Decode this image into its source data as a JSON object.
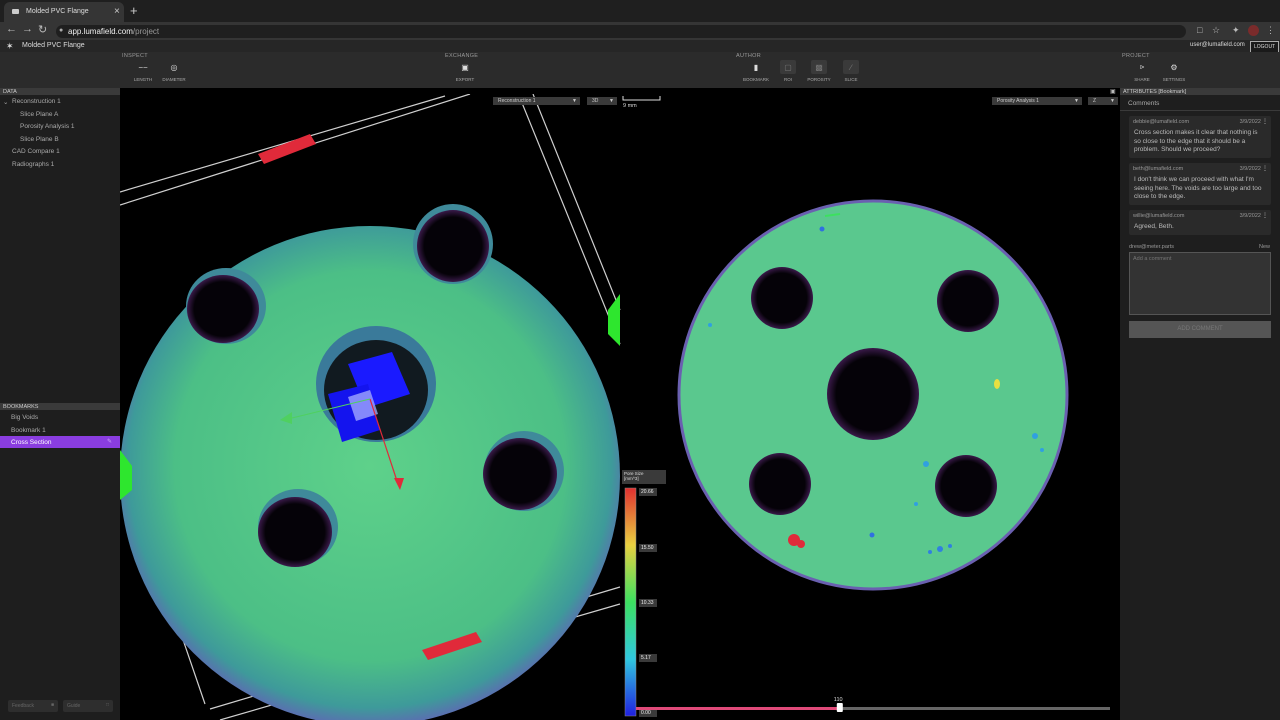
{
  "browser": {
    "tab_title": "Molded PVC Flange",
    "url_host": "app.lumafield.com",
    "url_path": "/project",
    "new_tab": "+",
    "close": "×"
  },
  "app": {
    "title": "Molded PVC Flange",
    "user_email": "user@lumafield.com",
    "logout_label": "LOGOUT"
  },
  "toolbar": {
    "groups": {
      "inspect": "INSPECT",
      "exchange": "EXCHANGE",
      "author": "AUTHOR",
      "project": "PROJECT"
    },
    "buttons": {
      "length": "LENGTH",
      "diameter": "DIAMETER",
      "export": "EXPORT",
      "bookmark": "BOOKMARK",
      "roi": "ROI",
      "porosity": "POROSITY",
      "slice": "SLICE",
      "share": "SHARE",
      "settings": "SETTINGS"
    }
  },
  "data_panel": {
    "header": "DATA",
    "items": [
      {
        "label": "Reconstruction 1"
      },
      {
        "label": "Slice Plane A"
      },
      {
        "label": "Porosity Analysis 1"
      },
      {
        "label": "Slice Plane B"
      },
      {
        "label": "CAD Compare 1"
      },
      {
        "label": "Radiographs 1"
      }
    ]
  },
  "bookmarks": {
    "header": "BOOKMARKS",
    "items": [
      {
        "label": "Big Voids"
      },
      {
        "label": "Bookmark 1"
      },
      {
        "label": "Cross Section"
      }
    ],
    "active_index": 2
  },
  "bottom_buttons": {
    "feedback": "Feedback",
    "guide": "Guide"
  },
  "viewport": {
    "left_view": {
      "dataset": "Reconstruction 1",
      "mode": "3D",
      "scale_label": "9 mm"
    },
    "right_view": {
      "dataset": "Porosity Analysis 1",
      "axis": "Z"
    },
    "legend": {
      "title_line1": "Pore Size",
      "title_line2": "[mm^3]",
      "ticks": [
        "20.66",
        "15.50",
        "10.33",
        "5.17",
        "0.00"
      ]
    },
    "slider": {
      "value": "110",
      "fraction": 0.43
    },
    "colors": {
      "part": "#4fbf80",
      "bookmark_active": "#8a3de0",
      "handle_red": "#e02a3a",
      "handle_green": "#2ee62e",
      "gizmo_blue": "#1a1aff"
    }
  },
  "attributes": {
    "header": "ATTRIBUTES [Bookmark]",
    "comments_title": "Comments",
    "comments": [
      {
        "author": "debbie@lumafield.com",
        "date": "3/9/2022",
        "text": "Cross section makes it clear that nothing is so close to the edge that it should be a problem. Should we proceed?"
      },
      {
        "author": "beth@lumafield.com",
        "date": "3/9/2022",
        "text": "I don't think we can proceed with what I'm seeing here. The voids are too large and too close to the edge."
      },
      {
        "author": "willie@lumafield.com",
        "date": "3/9/2022",
        "text": "Agreed, Beth."
      }
    ],
    "draft_author": "drew@meter.parts",
    "draft_new": "New",
    "input_placeholder": "Add a comment",
    "add_button": "ADD COMMENT"
  }
}
